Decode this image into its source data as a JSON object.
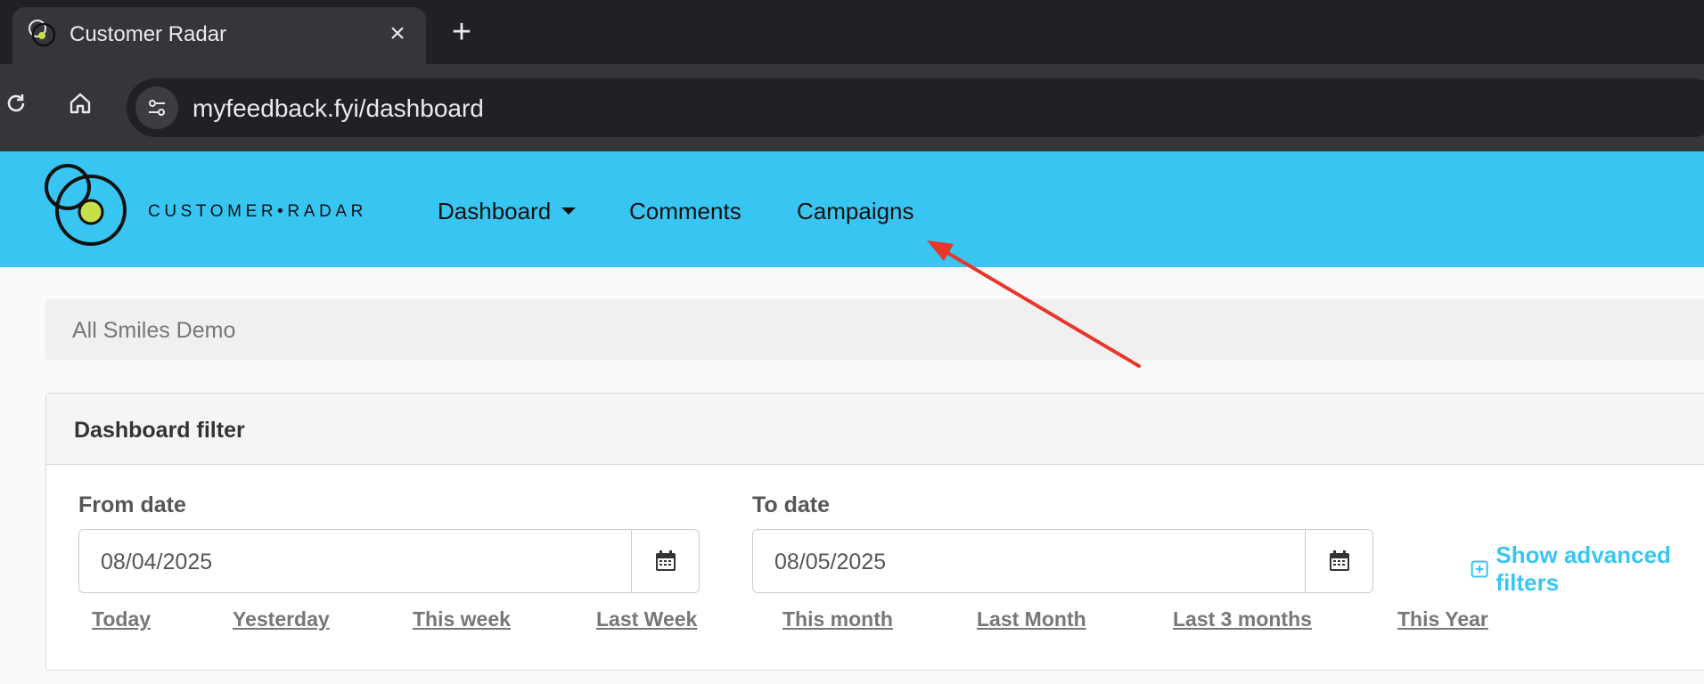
{
  "browser": {
    "tab": {
      "title": "Customer Radar",
      "close_icon": "×",
      "new_tab_icon": "+"
    },
    "address_bar": {
      "url": "myfeedback.fyi/dashboard"
    }
  },
  "app": {
    "brand": "CUSTOMER•RADAR",
    "nav": [
      {
        "label": "Dashboard"
      },
      {
        "label": "Comments"
      },
      {
        "label": "Campaigns"
      }
    ],
    "brand_colors": {
      "nav_bg": "#39c5f2",
      "logo_dot": "#c6e04a"
    }
  },
  "breadcrumb": "All Smiles Demo",
  "filter": {
    "title": "Dashboard filter",
    "from_label": "From date",
    "from_value": "08/04/2025",
    "to_label": "To date",
    "to_value": "08/05/2025",
    "advanced": "Show advanced filters",
    "quick_ranges": [
      "Today",
      "Yesterday",
      "This week",
      "Last Week",
      "This month",
      "Last Month",
      "Last 3 months",
      "This Year"
    ]
  },
  "annotation": {
    "type": "arrow",
    "color": "#e8362a",
    "points_to": "Campaigns"
  }
}
